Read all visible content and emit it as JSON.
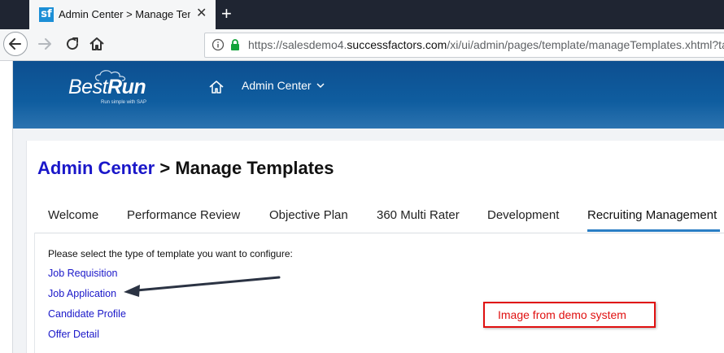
{
  "browser": {
    "tab_title": "Admin Center > Manage Temp",
    "favicon_text": "sf",
    "close_glyph": "✕",
    "new_tab_glyph": "+",
    "url_prefix": "https://salesdemo4.",
    "url_host": "successfactors.com",
    "url_path": "/xi/ui/admin/pages/template/manageTemplates.xhtml?tab"
  },
  "header": {
    "logo_best": "Best",
    "logo_run": "Run",
    "logo_tagline": "Run simple with SAP",
    "admin_menu_label": "Admin Center",
    "brand_color": "#0f5d9f"
  },
  "page": {
    "breadcrumb_link": "Admin Center",
    "breadcrumb_rest": " > Manage Templates",
    "tabs": [
      {
        "label": "Welcome"
      },
      {
        "label": "Performance Review"
      },
      {
        "label": "Objective Plan"
      },
      {
        "label": "360 Multi Rater"
      },
      {
        "label": "Development"
      },
      {
        "label": "Recruiting Management",
        "active": true
      }
    ],
    "prompt": "Please select the type of template you want to configure:",
    "links": [
      {
        "label": "Job Requisition"
      },
      {
        "label": "Job Application"
      },
      {
        "label": "Candidate Profile"
      },
      {
        "label": "Offer Detail"
      }
    ],
    "annotation": "Image from demo system",
    "link_color": "#1a17c9",
    "accent_color": "#2a7ec4",
    "annotation_color": "#e01010"
  }
}
